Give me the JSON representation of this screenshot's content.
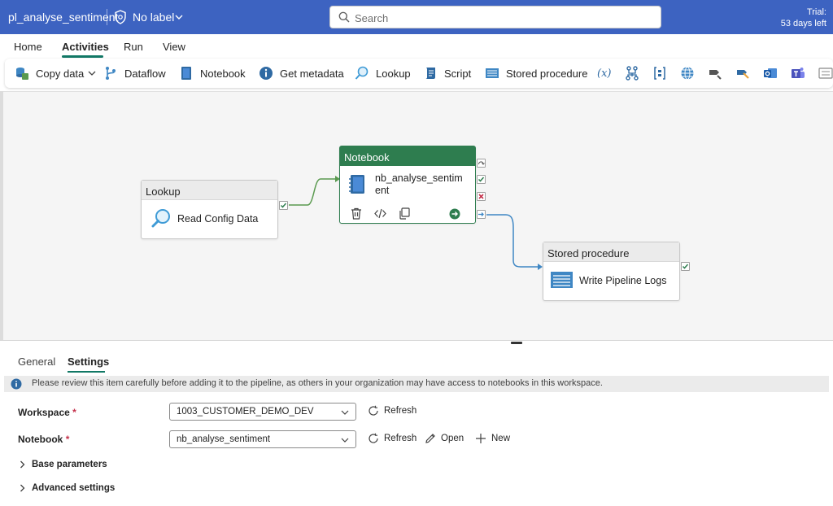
{
  "titlebar": {
    "pipeline_name": "pl_analyse_sentiment",
    "sensitivity_label": "No label",
    "search_placeholder": "Search",
    "trial_line1": "Trial:",
    "trial_line2": "53 days left"
  },
  "menu": {
    "tabs": [
      "Home",
      "Activities",
      "Run",
      "View"
    ],
    "active": "Activities"
  },
  "toolbar": {
    "copy_data": "Copy data",
    "dataflow": "Dataflow",
    "notebook": "Notebook",
    "get_metadata": "Get metadata",
    "lookup": "Lookup",
    "script": "Script",
    "stored_procedure": "Stored procedure",
    "variable_symbol": "(x)"
  },
  "canvas": {
    "lookup_node": {
      "type": "Lookup",
      "name": "Read Config Data"
    },
    "notebook_node": {
      "type": "Notebook",
      "name_line1": "nb_analyse_sentim",
      "name_line2": "ent"
    },
    "stored_proc_node": {
      "type": "Stored procedure",
      "name": "Write Pipeline Logs"
    }
  },
  "panel": {
    "tabs": [
      "General",
      "Settings"
    ],
    "active_tab": "Settings",
    "info_message": "Please review this item carefully before adding it to the pipeline, as others in your organization may have access to notebooks in this workspace.",
    "workspace": {
      "label": "Workspace",
      "required_mark": "*",
      "value": "1003_CUSTOMER_DEMO_DEV",
      "refresh": "Refresh"
    },
    "notebook": {
      "label": "Notebook",
      "required_mark": "*",
      "value": "nb_analyse_sentiment",
      "refresh": "Refresh",
      "open": "Open",
      "new": "New"
    },
    "base_parameters": "Base parameters",
    "advanced_settings": "Advanced settings"
  },
  "colors": {
    "titlebar_bg": "#3d63c1",
    "accent_green": "#117865",
    "selected_node_header": "#2e7d4f",
    "success_check": "#2e7d4f",
    "failure_x": "#c4314b",
    "connector_green": "#5a9a4f",
    "connector_blue": "#3f87c4"
  }
}
